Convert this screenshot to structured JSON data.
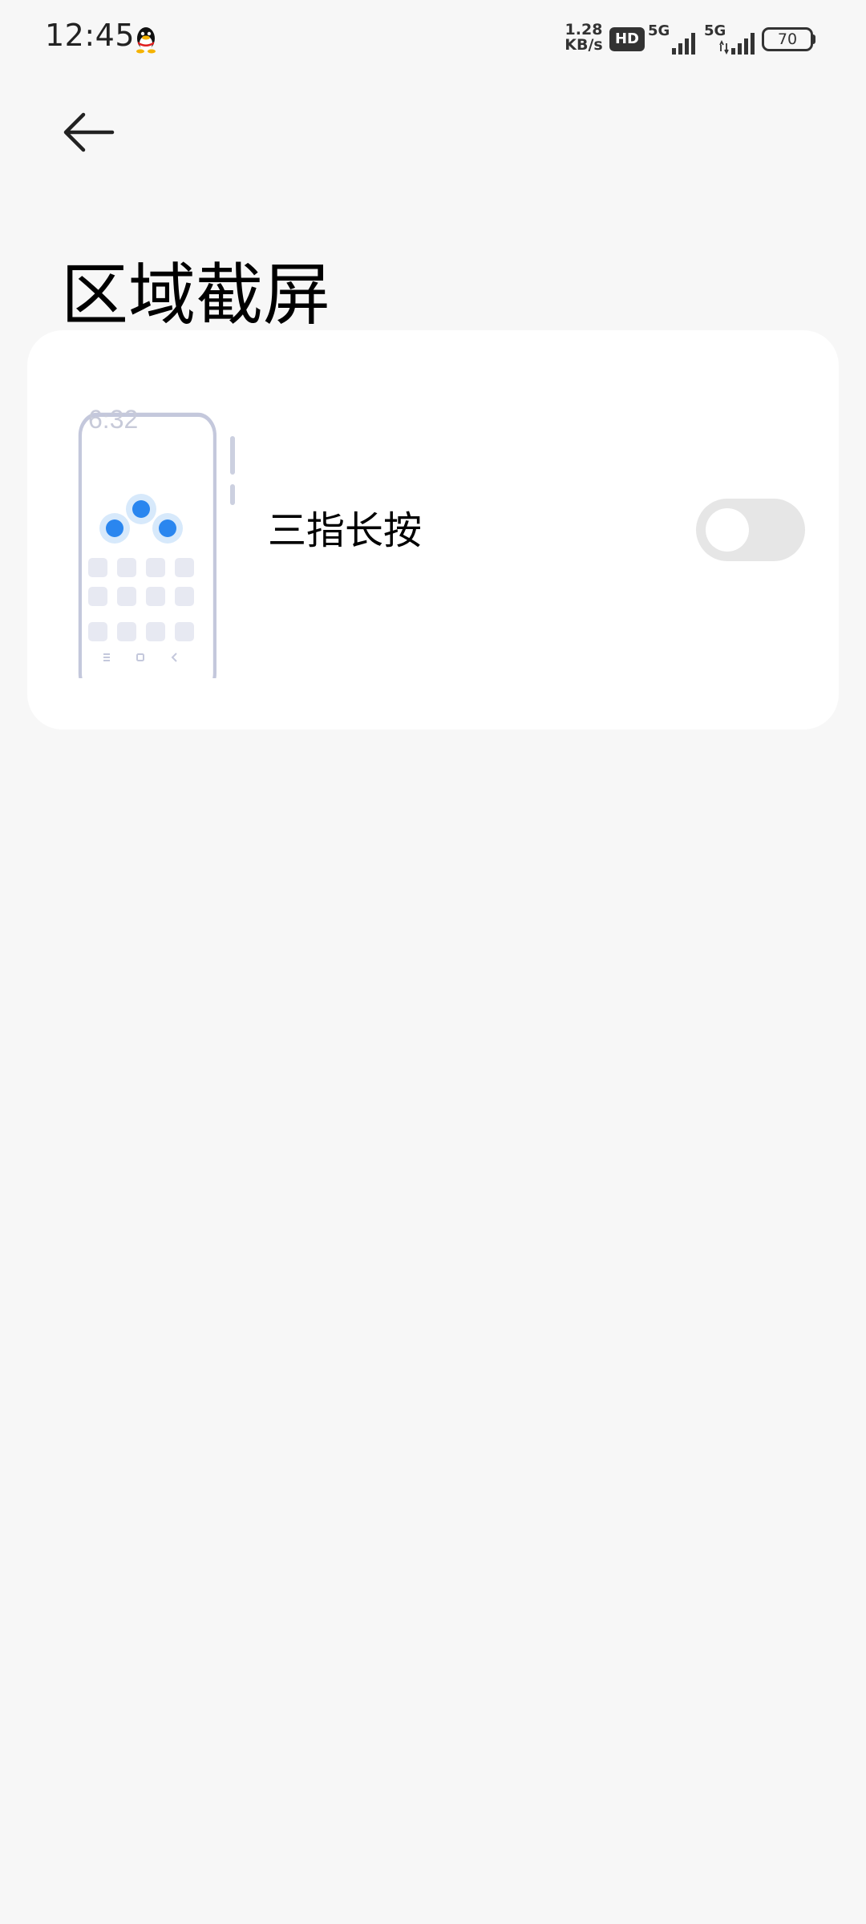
{
  "status_bar": {
    "time": "12:45",
    "net_speed_value": "1.28",
    "net_speed_unit": "KB/s",
    "hd_label": "HD",
    "sim1_label": "5G",
    "sim2_label": "5G",
    "battery_level": "70"
  },
  "page": {
    "title": "区域截屏"
  },
  "setting": {
    "label": "三指长按",
    "enabled": false,
    "illustration_time": "6:32"
  },
  "colors": {
    "accent_dot": "#2a86ef",
    "toggle_off": "#e6e6e6",
    "background": "#f7f7f7"
  }
}
